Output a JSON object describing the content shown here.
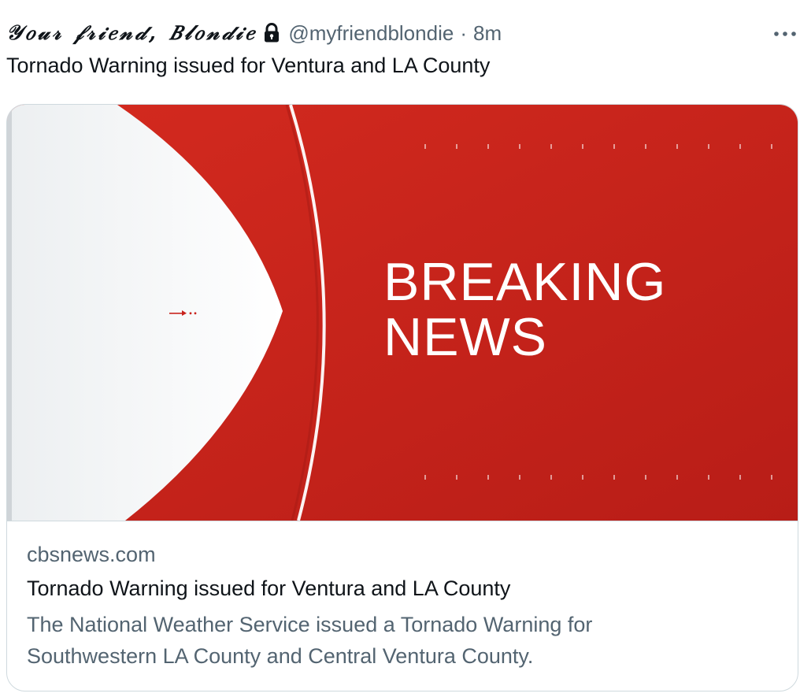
{
  "tweet": {
    "display_name": "𝒴𝑜𝓊𝓇 𝒻𝓇𝒾𝑒𝓃𝒹, 𝐵𝓁𝑜𝓃𝒹𝒾𝑒",
    "handle": "@myfriendblondie",
    "separator": "·",
    "time": "8m",
    "text": "Tornado Warning issued for Ventura and LA County",
    "protected_icon": "lock-icon",
    "more_icon": "more-horizontal-icon"
  },
  "card": {
    "image": {
      "headline_line1": "BREAKING",
      "headline_line2": "NEWS",
      "brand_red": "#c8221b",
      "brand_white": "#ffffff"
    },
    "domain": "cbsnews.com",
    "title": "Tornado Warning issued for Ventura and LA County",
    "description_line1": "The National Weather Service issued a Tornado Warning for",
    "description_line2": "Southwestern LA County and Central Ventura County."
  },
  "colors": {
    "text_primary": "#0f1419",
    "text_secondary": "#536471",
    "border": "#cfd9de"
  }
}
